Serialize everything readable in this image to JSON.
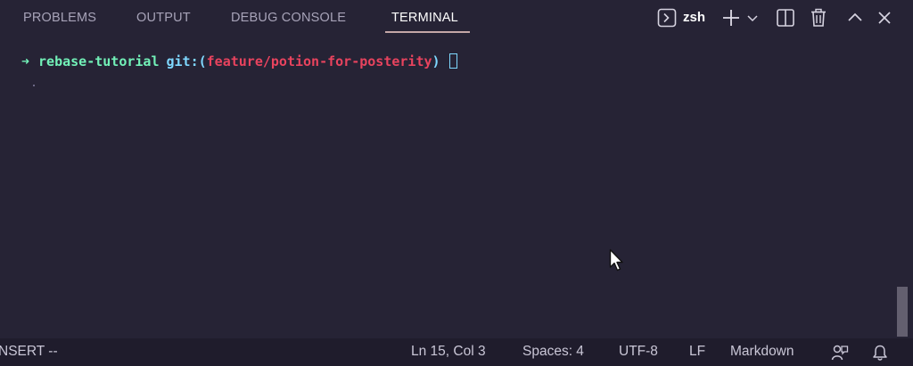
{
  "panel": {
    "tabs": [
      {
        "label": "PROBLEMS",
        "active": false
      },
      {
        "label": "OUTPUT",
        "active": false
      },
      {
        "label": "DEBUG CONSOLE",
        "active": false
      },
      {
        "label": "TERMINAL",
        "active": true
      }
    ],
    "shell_label": "zsh",
    "icons": [
      "terminal-icon",
      "plus-icon",
      "chevron-down-icon",
      "split-icon",
      "trash-icon",
      "chevron-up-icon",
      "close-icon"
    ]
  },
  "terminal": {
    "prompt_arrow": "➜",
    "directory": "rebase-tutorial",
    "git_prefix": "git:(",
    "branch": "feature/potion-for-posterity",
    "git_suffix": ")"
  },
  "statusbar": {
    "mode": "NSERT --",
    "position": "Ln 15, Col 3",
    "spaces": "Spaces: 4",
    "encoding": "UTF-8",
    "eol": "LF",
    "language": "Markdown"
  },
  "colors": {
    "background": "#262335",
    "statusbar": "#1f1c2c",
    "prompt_green": "#72f1b8",
    "git_cyan": "#7fd8ff",
    "branch_red": "#e8435e"
  }
}
